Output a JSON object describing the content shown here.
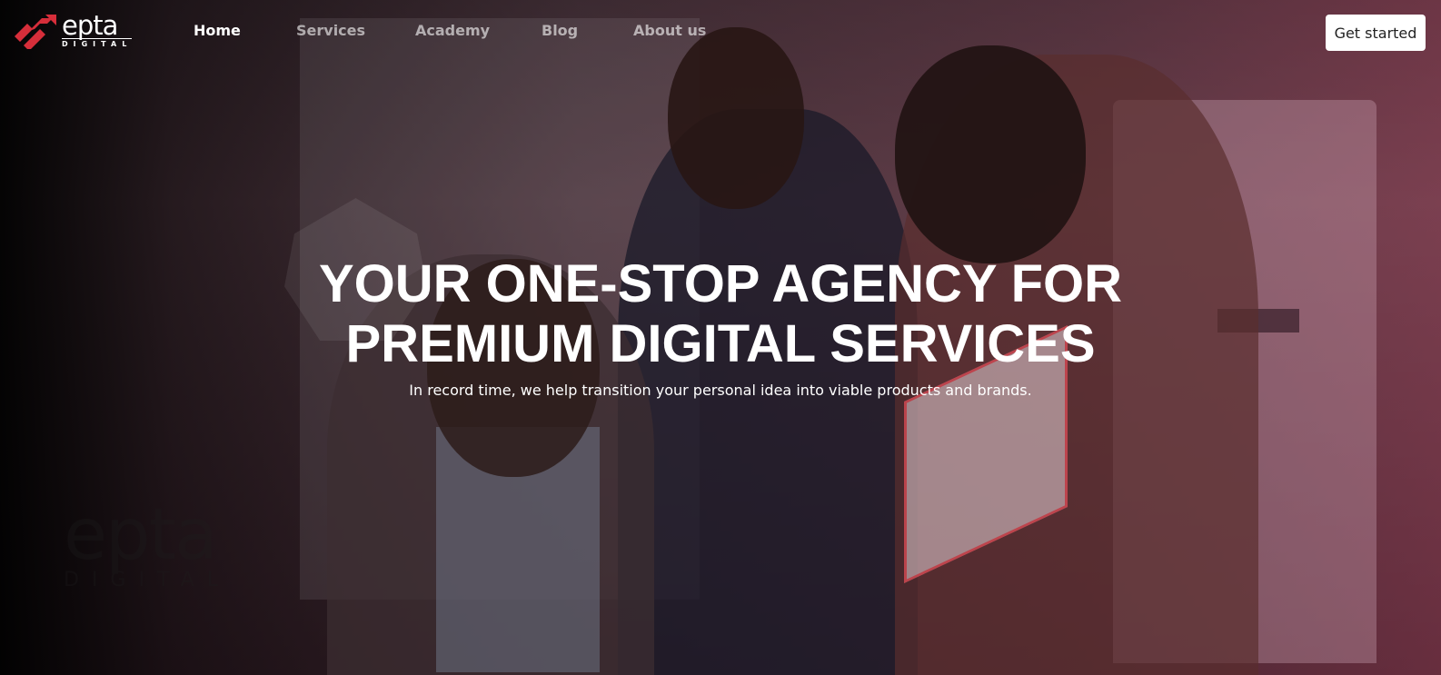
{
  "brand": {
    "name": "epta",
    "subtitle": "DIGITAL",
    "accent_color": "#d62e3a"
  },
  "nav": {
    "items": [
      {
        "label": "Home",
        "active": true
      },
      {
        "label": "Services",
        "active": false
      },
      {
        "label": "Academy",
        "active": false
      },
      {
        "label": "Blog",
        "active": false
      },
      {
        "label": "About us",
        "active": false
      }
    ],
    "cta_label": "Get started"
  },
  "hero": {
    "title_line1": "YOUR ONE-STOP AGENCY FOR",
    "title_line2": "PREMIUM DIGITAL SERVICES",
    "subtitle": "In record time, we help transition your personal idea into viable products and brands.",
    "overlay_color": "#8c3450"
  },
  "background": {
    "wall_logo_name": "epta",
    "wall_logo_subtitle": "DIGITAL"
  }
}
